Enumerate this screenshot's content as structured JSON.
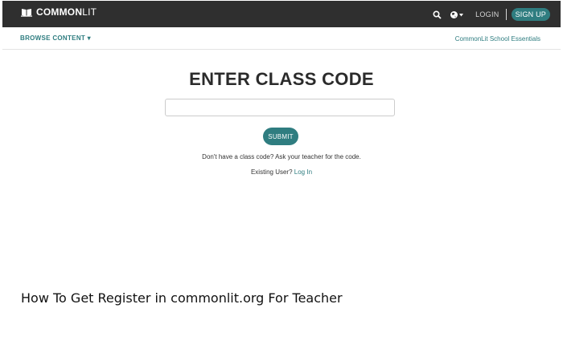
{
  "header": {
    "logo_bold": "COMMON",
    "logo_light": "LIT",
    "login_label": "LOGIN",
    "signup_label": "SIGN UP",
    "icons": [
      "book-icon",
      "search-icon",
      "globe-icon"
    ]
  },
  "subnav": {
    "browse_label": "BROWSE CONTENT ▾",
    "essentials_label": "CommonLit School Essentials"
  },
  "main": {
    "heading": "ENTER CLASS CODE",
    "code_value": "",
    "submit_label": "SUBMIT",
    "hint": "Don't have a class code? Ask your teacher for the code.",
    "existing_prefix": "Existing User?",
    "login_link": "Log In"
  },
  "caption": "How To Get Register in commonlit.org For Teacher",
  "colors": {
    "header_bg": "#2f2f2f",
    "accent": "#2f7d80",
    "text": "#2b2b2b"
  }
}
